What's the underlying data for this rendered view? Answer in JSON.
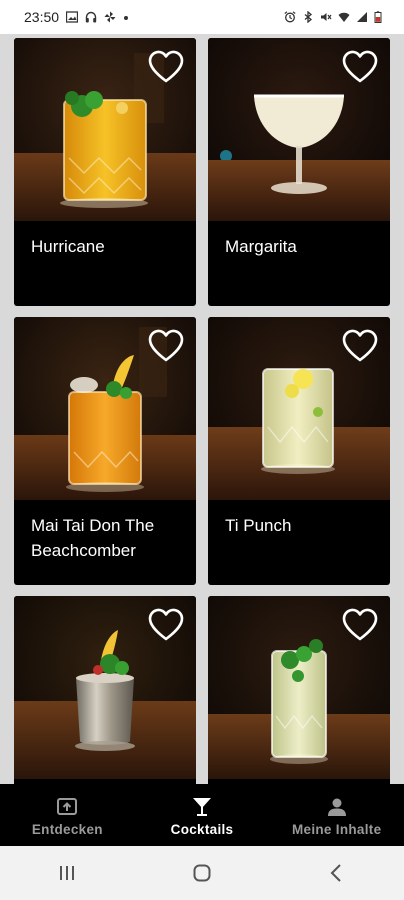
{
  "status_bar": {
    "time": "23:50",
    "left_icons": [
      "image-icon",
      "headphones-icon",
      "pinwheel-icon",
      "dot-icon"
    ],
    "right_icons": [
      "alarm-icon",
      "bluetooth-icon",
      "mute-icon",
      "wifi-icon",
      "signal-icon",
      "battery-icon"
    ]
  },
  "cocktails": [
    {
      "name": "Hurricane",
      "glass": "rocks",
      "drink_color": "#f3b21a",
      "garnish": "mint"
    },
    {
      "name": "Margarita",
      "glass": "coupe",
      "drink_color": "#efe9d0",
      "garnish": "none"
    },
    {
      "name": "Mai Tai Don The Beachcomber",
      "glass": "rocks",
      "drink_color": "#f19a1c",
      "garnish": "pineapple-mint"
    },
    {
      "name": "Ti Punch",
      "glass": "rocks",
      "drink_color": "#e9e8b0",
      "garnish": "lime"
    },
    {
      "name": "",
      "glass": "julep-cup",
      "drink_color": "#b9a78a",
      "garnish": "pineapple-mint"
    },
    {
      "name": "",
      "glass": "highball",
      "drink_color": "#dfe2b9",
      "garnish": "mint"
    }
  ],
  "bottom_nav": {
    "items": [
      {
        "label": "Entdecken",
        "icon": "discover-icon",
        "active": false
      },
      {
        "label": "Cocktails",
        "icon": "cocktail-glass-icon",
        "active": true
      },
      {
        "label": "Meine Inhalte",
        "icon": "person-icon",
        "active": false
      }
    ]
  },
  "system_nav": {
    "buttons": [
      "recent-apps-icon",
      "home-icon",
      "back-icon"
    ]
  }
}
